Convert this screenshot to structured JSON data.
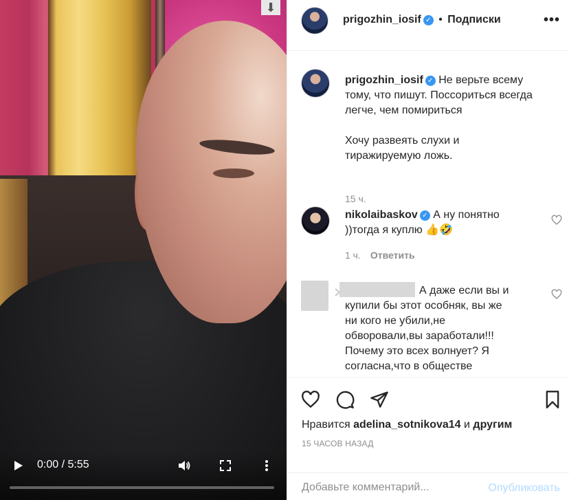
{
  "video": {
    "time_current": "0:00",
    "time_total": "5:55",
    "time_display": "0:00 / 5:55",
    "progress_fraction": 0.0
  },
  "header": {
    "username": "prigozhin_iosif",
    "separator": "•",
    "follow_label": "Подписки"
  },
  "comments": [
    {
      "username": "prigozhin_iosif",
      "text_line1": "Не верьте всему",
      "text_line2": "тому, что пишут. Поссориться всегда",
      "text_line3": "легче, чем помириться",
      "text_line4": "Хочу развеять слухи и",
      "text_line5": "тиражируемую ложь.",
      "time": "15 ч."
    },
    {
      "username": "nikolaibaskov",
      "text_line1": "А ну понятно",
      "text_line2": "))тогда я куплю 👍🤣",
      "time": "1 ч.",
      "reply_label": "Ответить"
    },
    {
      "username_redacted": true,
      "text_line1": "А даже если вы и",
      "text_line2": "купили бы этот особняк, вы же",
      "text_line3": "ни кого не убили,не",
      "text_line4": "обворовали,вы заработали!!!",
      "text_line5": "Почему это всех волнует? Я",
      "text_line6": "согласна,что в обществе"
    }
  ],
  "likes": {
    "prefix": "Нравится",
    "user": "adelina_sotnikova14",
    "conj": "и",
    "others": "другим"
  },
  "timestamp": "15 ЧАСОВ НАЗАД",
  "composer": {
    "placeholder": "Добавьте комментарий...",
    "publish_label": "Опубликовать"
  },
  "colors": {
    "verified": "#3897f0",
    "publish_disabled": "#b3dbff",
    "muted": "#8e8e8e",
    "text": "#262626"
  },
  "icons": [
    "download-icon",
    "play-icon",
    "volume-icon",
    "fullscreen-icon",
    "more-vertical-icon",
    "more-horizontal-icon",
    "verified-icon",
    "heart-icon",
    "comment-icon",
    "share-icon",
    "bookmark-icon"
  ]
}
